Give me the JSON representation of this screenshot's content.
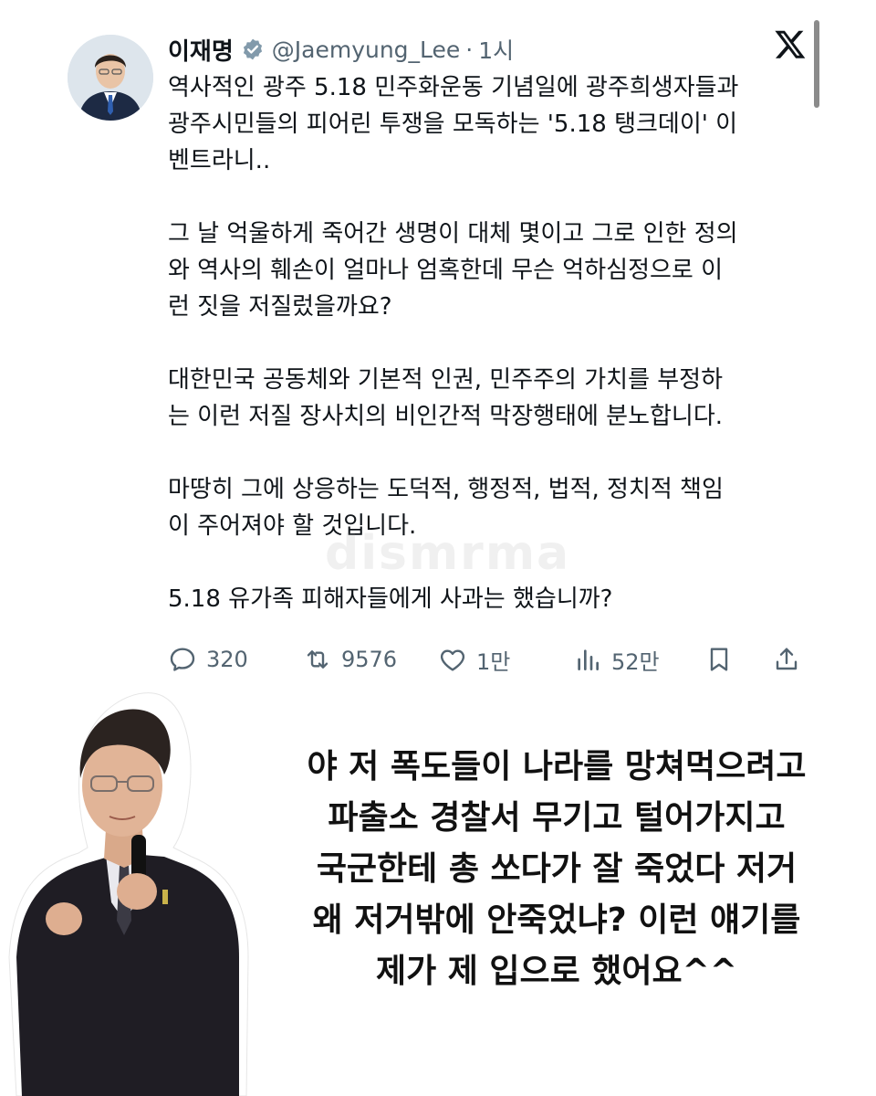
{
  "tweet": {
    "name": "이재명",
    "handle": "@Jaemyung_Lee",
    "separator": "·",
    "time": "1시",
    "paragraphs": [
      [
        "역사적인 광주 5.18 민주화운동 기념일에 광주희생자들과",
        "광주시민들의 피어린 투쟁을 모독하는 '5.18 탱크데이' 이",
        "벤트라니.."
      ],
      [
        "그 날 억울하게 죽어간 생명이 대체 몇이고 그로 인한 정의",
        "와 역사의 훼손이 얼마나 엄혹한데 무슨 억하심정으로 이",
        "런 짓을 저질렀을까요?"
      ],
      [
        "대한민국 공동체와 기본적 인권, 민주주의 가치를 부정하",
        "는 이런 저질 장사치의 비인간적 막장행태에 분노합니다."
      ],
      [
        "마땅히 그에 상응하는 도덕적, 행정적, 법적, 정치적 책임",
        "이 주어져야 할 것입니다."
      ],
      [
        "5.18 유가족 피해자들에게 사과는 했습니까?"
      ]
    ],
    "actions": {
      "replies": "320",
      "retweets": "9576",
      "likes": "1만",
      "views": "52만"
    }
  },
  "watermark": "dismrma",
  "caption_lines": [
    "야 저 폭도들이 나라를 망쳐먹으려고",
    "파출소 경찰서 무기고 털어가지고",
    "국군한테 총 쏘다가 잘 죽었다 저거",
    "왜 저거밖에 안죽었냐? 이런 얘기를",
    "제가 제 입으로 했어요^^"
  ],
  "colors": {
    "text": "#0f1419",
    "muted": "#536471",
    "verified_badge": "#829aab"
  },
  "icons": [
    "verified-icon",
    "x-logo-icon",
    "reply-icon",
    "retweet-icon",
    "like-icon",
    "views-icon",
    "bookmark-icon",
    "share-icon"
  ]
}
